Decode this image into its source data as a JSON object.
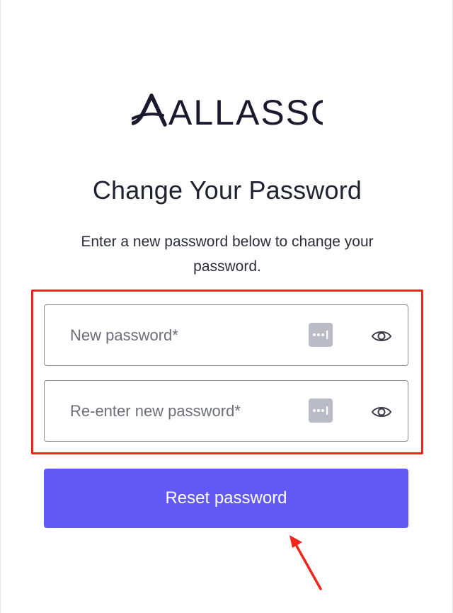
{
  "brand": {
    "logo_text": "ALLASSO"
  },
  "heading": {
    "title": "Change Your Password"
  },
  "description": {
    "text": "Enter a new password below to change your password."
  },
  "form": {
    "new_password": {
      "placeholder": "New password*",
      "value": ""
    },
    "confirm_password": {
      "placeholder": "Re-enter new password*",
      "value": ""
    },
    "submit_label": "Reset password"
  },
  "icons": {
    "password_manager": "password-manager-icon",
    "visibility_toggle": "eye-icon"
  },
  "colors": {
    "accent": "#6259f4",
    "annotation": "#f0261b",
    "logo": "#1a1a2e"
  }
}
